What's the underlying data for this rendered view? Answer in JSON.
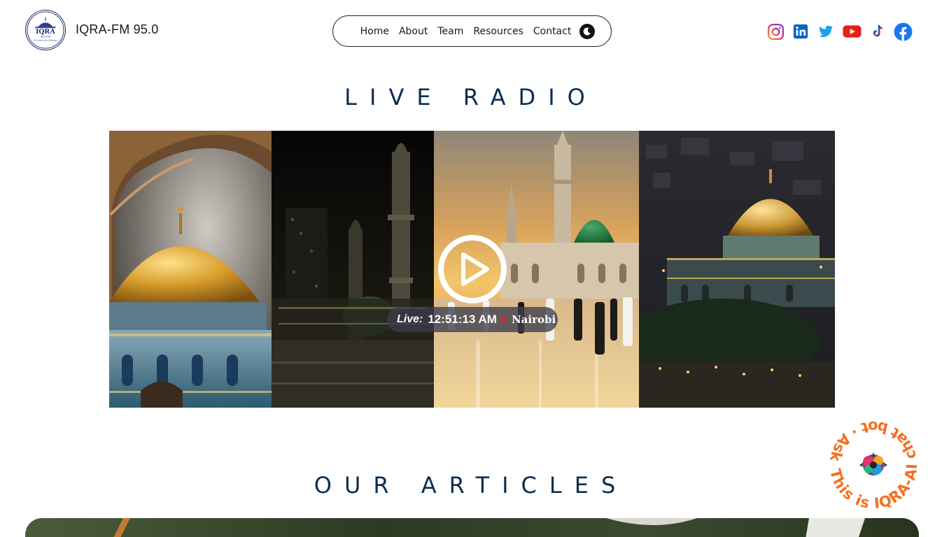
{
  "brand": {
    "name": "IQRA-FM 95.0",
    "logo_text": "IQRA",
    "logo_freq": "95.0 FM",
    "logo_tagline": "The Station with a Difference"
  },
  "nav": {
    "items": [
      {
        "label": "Home"
      },
      {
        "label": "About"
      },
      {
        "label": "Team"
      },
      {
        "label": "Resources"
      },
      {
        "label": "Contact"
      }
    ]
  },
  "social": [
    {
      "icon": "instagram-icon"
    },
    {
      "icon": "linkedin-icon"
    },
    {
      "icon": "twitter-icon"
    },
    {
      "icon": "youtube-icon"
    },
    {
      "icon": "tiktok-icon"
    },
    {
      "icon": "facebook-icon"
    }
  ],
  "live_radio": {
    "title": "LIVE RADIO",
    "live_label": "Live:",
    "time": "12:51:13 AM",
    "city": "Nairobi"
  },
  "articles": {
    "title": "OUR ARTICLES"
  },
  "chatbot": {
    "ring_text": "This is IQRA-AI chat bot · Ask Me · "
  },
  "colors": {
    "heading": "#0b2e52",
    "accent": "#f37021",
    "live_dot": "#e0222a"
  }
}
